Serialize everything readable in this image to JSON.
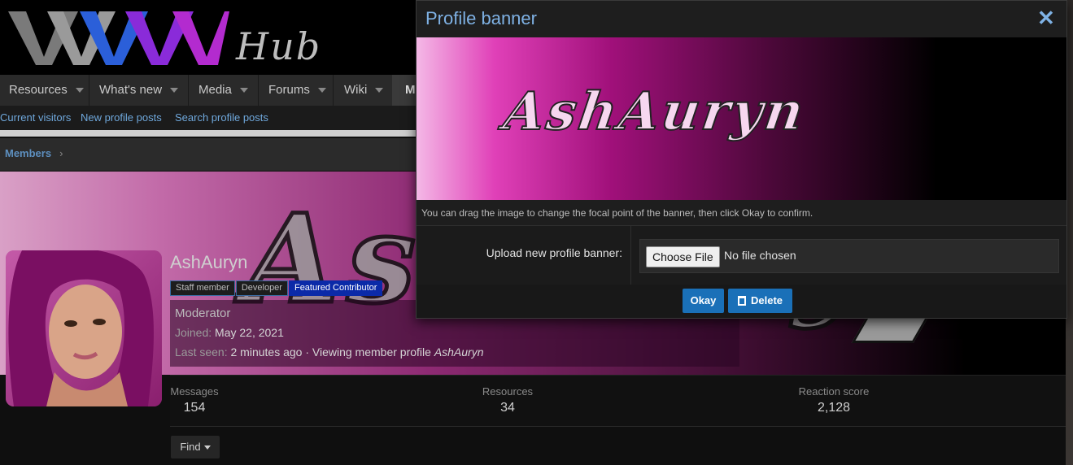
{
  "site": {
    "logo_text": "Hub"
  },
  "nav": {
    "items": [
      {
        "label": "Resources"
      },
      {
        "label": "What's new"
      },
      {
        "label": "Media"
      },
      {
        "label": "Forums"
      },
      {
        "label": "Wiki"
      },
      {
        "label": "M"
      }
    ]
  },
  "subnav": {
    "links": [
      "Current visitors",
      "New profile posts",
      "Search profile posts"
    ]
  },
  "breadcrumb": {
    "label": "Members"
  },
  "profile": {
    "username": "AshAuryn",
    "badges": [
      "Staff member",
      "Developer",
      "Featured Contributor"
    ],
    "role": "Moderator",
    "joined_label": "Joined:",
    "joined_value": "May 22, 2021",
    "last_seen_label": "Last seen:",
    "last_seen_value": "2 minutes ago · Viewing member profile",
    "last_seen_name": "AshAuryn",
    "banner_text": "AshAuryn"
  },
  "stats": [
    {
      "label": "Messages",
      "value": "154"
    },
    {
      "label": "Resources",
      "value": "34"
    },
    {
      "label": "Reaction score",
      "value": "2,128"
    }
  ],
  "find_button": "Find",
  "modal": {
    "title": "Profile banner",
    "close_glyph": "✕",
    "banner_text": "AshAuryn",
    "hint": "You can drag the image to change the focal point of the banner, then click Okay to confirm.",
    "upload_label": "Upload new profile banner:",
    "file_button": "Choose File",
    "file_status": "No file chosen",
    "okay_label": "Okay",
    "delete_label": "Delete"
  },
  "colors": {
    "accent": "#1a70b8",
    "link": "#6fa8dc",
    "featured_badge": "#0b2aa8",
    "banner_pink": "#e040b8"
  }
}
